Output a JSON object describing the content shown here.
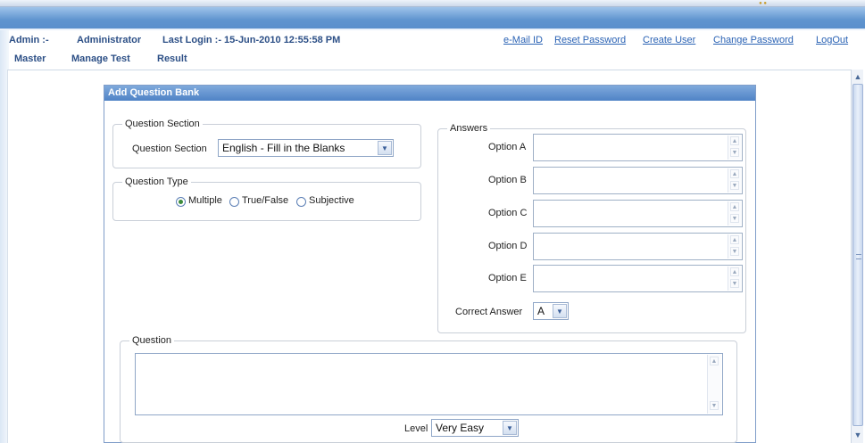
{
  "user_info": {
    "role_label": "Admin :-",
    "role_value": "Administrator",
    "last_login": "Last Login :- 15-Jun-2010 12:55:58 PM"
  },
  "top_links": [
    "e-Mail ID",
    "Reset Password",
    "Create User",
    "Change Password",
    "LogOut"
  ],
  "menu": [
    "Master",
    "Manage Test",
    "Result"
  ],
  "panel_title": "Add Question Bank",
  "question_section": {
    "legend": "Question Section",
    "label": "Question Section",
    "selected": "English - Fill in the Blanks"
  },
  "question_type": {
    "legend": "Question Type",
    "options": [
      "Multiple",
      "True/False",
      "Subjective"
    ],
    "selected": "Multiple"
  },
  "answers": {
    "legend": "Answers",
    "options": [
      "Option A",
      "Option B",
      "Option C",
      "Option D",
      "Option E"
    ],
    "correct_label": "Correct Answer",
    "correct_value": "A"
  },
  "question": {
    "legend": "Question",
    "level_label": "Level",
    "level_value": "Very Easy"
  },
  "colors": {
    "header_band": "#5f94cf",
    "panel_title": "#4f83c6",
    "link": "#2a62b4",
    "menu_text": "#2c4f86"
  }
}
